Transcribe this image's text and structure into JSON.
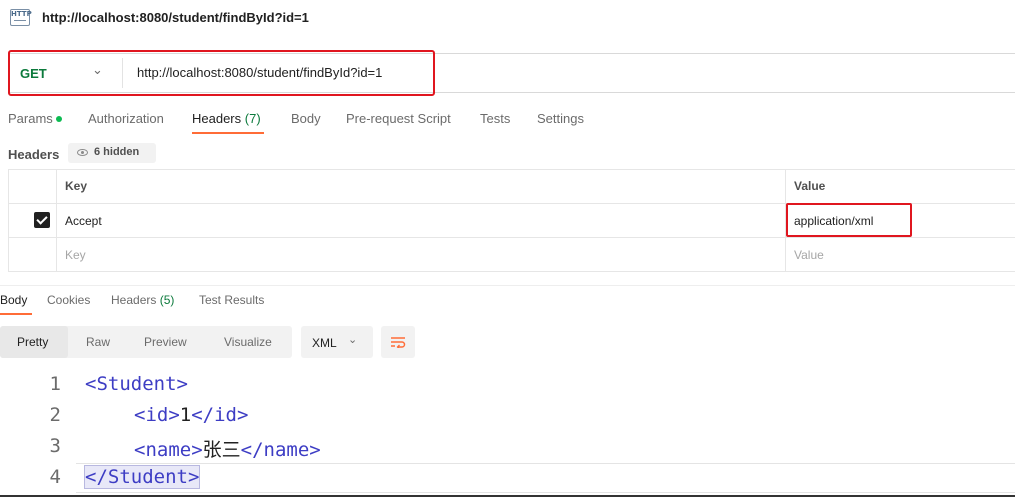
{
  "window": {
    "icon": "http-file-icon",
    "icon_text": "HTTP",
    "title": "http://localhost:8080/student/findById?id=1"
  },
  "request": {
    "method": "GET",
    "url": "http://localhost:8080/student/findById?id=1"
  },
  "request_tabs": [
    {
      "label": "Params",
      "indicator": "dot"
    },
    {
      "label": "Authorization"
    },
    {
      "label": "Headers",
      "count": "(7)",
      "active": true
    },
    {
      "label": "Body"
    },
    {
      "label": "Pre-request Script"
    },
    {
      "label": "Tests"
    },
    {
      "label": "Settings"
    }
  ],
  "headers_section": {
    "label": "Headers",
    "hidden_text": "6 hidden",
    "columns": [
      "Key",
      "Value"
    ],
    "rows": [
      {
        "checked": true,
        "key": "Accept",
        "value": "application/xml"
      }
    ],
    "placeholder": {
      "key": "Key",
      "value": "Value"
    }
  },
  "response_tabs": [
    {
      "label": "Body",
      "active": true
    },
    {
      "label": "Cookies"
    },
    {
      "label": "Headers",
      "count": "(5)"
    },
    {
      "label": "Test Results"
    }
  ],
  "view_modes": [
    "Pretty",
    "Raw",
    "Preview",
    "Visualize"
  ],
  "active_view": "Pretty",
  "format": "XML",
  "code": {
    "lines": [
      {
        "n": "1",
        "open": "<Student>",
        "text": "",
        "close": ""
      },
      {
        "n": "2",
        "open": "<id>",
        "text": "1",
        "close": "</id>"
      },
      {
        "n": "3",
        "open": "<name>",
        "text": "张三",
        "close": "</name>"
      },
      {
        "n": "4",
        "open": "",
        "text": "",
        "close": "</Student>"
      }
    ]
  },
  "colors": {
    "accent": "#ff6c37",
    "method_green": "#0c7a3c",
    "highlight_red": "#e0161f",
    "xml_tag": "#3d3dc4"
  }
}
